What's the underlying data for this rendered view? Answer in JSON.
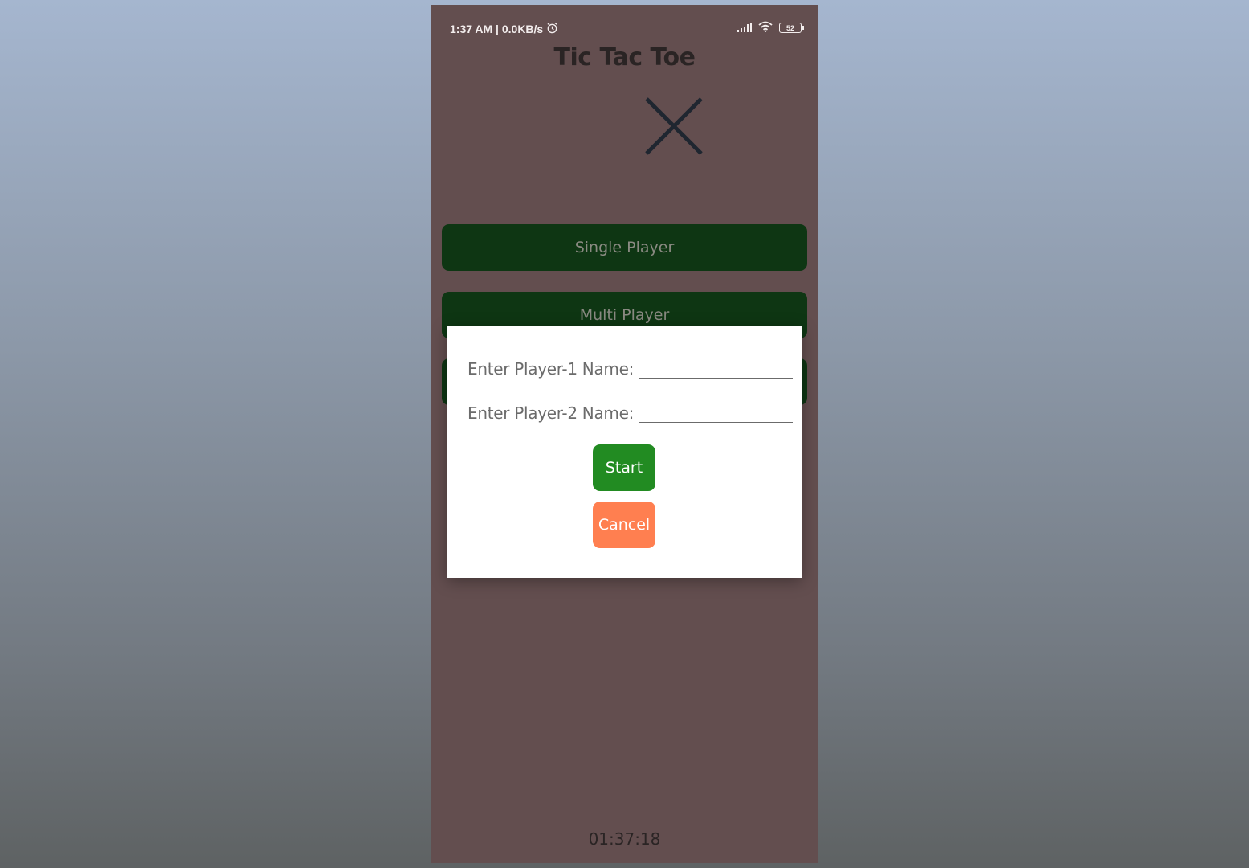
{
  "status_bar": {
    "time_info": "1:37 AM | 0.0KB/s",
    "alarm_icon": "alarm-clock-icon",
    "signal_icon": "cell-signal-icon",
    "wifi_icon": "wifi-icon",
    "battery_level": "52"
  },
  "app": {
    "title": "Tic Tac Toe",
    "logo_icon": "x-mark-icon",
    "background_color": "#634e4f"
  },
  "menu": {
    "single_player_label": "Single Player",
    "multi_player_label": "Multi Player",
    "button_color": "#0e3613"
  },
  "timer": {
    "value": "01:37:18"
  },
  "dialog": {
    "player1_label": "Enter Player-1 Name:",
    "player1_value": "",
    "player2_label": "Enter Player-2 Name:",
    "player2_value": "",
    "start_label": "Start",
    "cancel_label": "Cancel",
    "start_color": "#228b22",
    "cancel_color": "#ff7f50"
  }
}
